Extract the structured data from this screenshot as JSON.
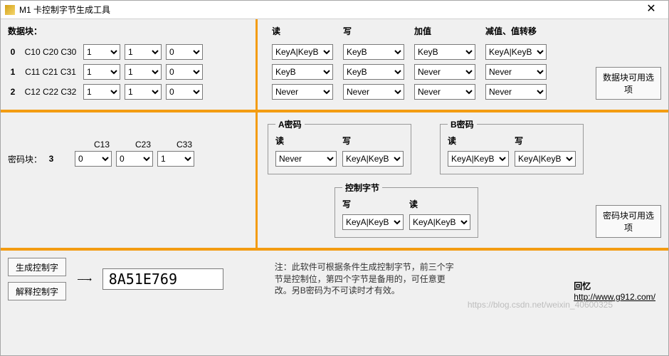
{
  "window": {
    "title": "M1 卡控制字节生成工具"
  },
  "section1": {
    "data_label": "数据块：",
    "rows": [
      {
        "idx": "0",
        "bits": "C10 C20 C30",
        "c1": "1",
        "c2": "1",
        "c3": "0"
      },
      {
        "idx": "1",
        "bits": "C11 C21 C31",
        "c1": "1",
        "c2": "1",
        "c3": "0"
      },
      {
        "idx": "2",
        "bits": "C12 C22 C32",
        "c1": "1",
        "c2": "1",
        "c3": "0"
      }
    ],
    "headers": {
      "read": "读",
      "write": "写",
      "inc": "加值",
      "dec": "减值、值转移"
    },
    "ops": {
      "r0": {
        "read": "KeyA|KeyB",
        "write": "KeyB",
        "inc": "KeyB",
        "dec": "KeyA|KeyB"
      },
      "r1": {
        "read": "KeyB",
        "write": "KeyB",
        "inc": "Never",
        "dec": "Never"
      },
      "r2": {
        "read": "Never",
        "write": "Never",
        "inc": "Never",
        "dec": "Never"
      }
    },
    "side_button": "数据块可用选项"
  },
  "section2": {
    "left_label": "密码块：",
    "left_idx": "3",
    "c_headers": {
      "c13": "C13",
      "c23": "C23",
      "c33": "C33"
    },
    "c_values": {
      "c13": "0",
      "c23": "0",
      "c33": "1"
    },
    "a_box": {
      "legend": "A密码",
      "read_l": "读",
      "write_l": "写",
      "read_v": "Never",
      "write_v": "KeyA|KeyB"
    },
    "b_box": {
      "legend": "B密码",
      "read_l": "读",
      "write_l": "写",
      "read_v": "KeyA|KeyB",
      "write_v": "KeyA|KeyB"
    },
    "ctrl_box": {
      "legend": "控制字节",
      "write_l": "写",
      "read_l": "读",
      "write_v": "KeyA|KeyB",
      "read_v": "KeyA|KeyB"
    },
    "side_button": "密码块可用选项"
  },
  "section3": {
    "gen_btn": "生成控制字",
    "parse_btn": "解释控制字",
    "arrow": "——→",
    "result": "8A51E769",
    "note": "注：此软件可根据条件生成控制字节，前三个字节是控制位，第四个字节是备用的，可任意更改。另B密码为不可读时才有效。",
    "footer_name": "回忆",
    "footer_url": "http://www.g912.com/",
    "watermark": "https://blog.csdn.net/weixin_40600325"
  }
}
